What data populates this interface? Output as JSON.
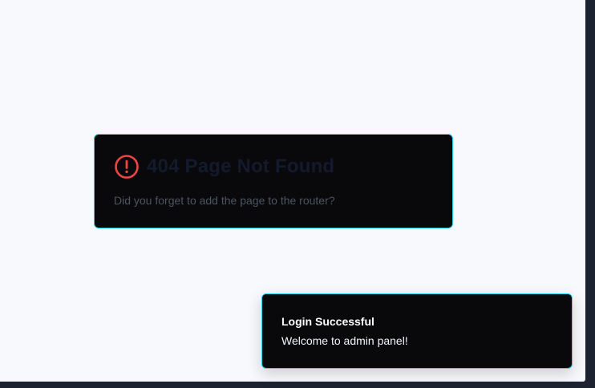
{
  "colors": {
    "page_background": "#f8f9fc",
    "card_background": "#09090b",
    "border_accent": "#22d3ee",
    "alert_red": "#ef4444"
  },
  "not_found_card": {
    "icon": "alert-circle-icon",
    "title": "404 Page Not Found",
    "description": "Did you forget to add the page to the router?"
  },
  "toast": {
    "title": "Login Successful",
    "description": "Welcome to admin panel!"
  }
}
